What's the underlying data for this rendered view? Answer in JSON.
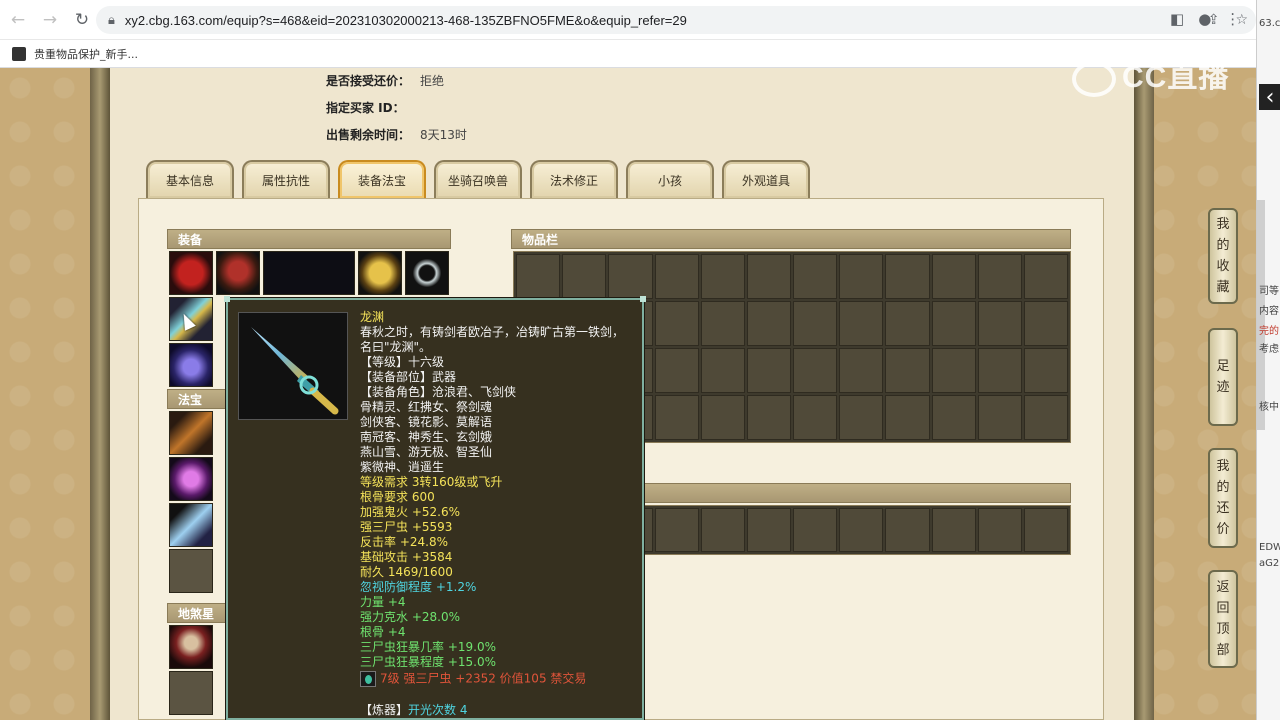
{
  "browser": {
    "url": "xy2.cbg.163.com/equip?s=468&eid=202310302000213-468-135ZBFNO5FME&o&equip_refer=29",
    "bookmark_label": "贵重物品保护_新手..."
  },
  "info": [
    {
      "key": "是否接受还价：",
      "value": "拒绝"
    },
    {
      "key": "指定买家 ID：",
      "value": ""
    },
    {
      "key": "出售剩余时间：",
      "value": "8天13时"
    }
  ],
  "tabs": [
    {
      "label": "基本信息",
      "active": false
    },
    {
      "label": "属性抗性",
      "active": false
    },
    {
      "label": "装备法宝",
      "active": true
    },
    {
      "label": "坐骑召唤兽",
      "active": false
    },
    {
      "label": "法术修正",
      "active": false
    },
    {
      "label": "小孩",
      "active": false
    },
    {
      "label": "外观道具",
      "active": false
    }
  ],
  "sections": {
    "equip": "装备",
    "fabao": "法宝",
    "disha": "地煞星",
    "inventory": "物品栏"
  },
  "tooltip": {
    "name": "龙渊",
    "desc1": "春秋之时，有铸剑者欧冶子，冶铸旷古第一铁剑，",
    "desc2": "名曰\"龙渊\"。",
    "level": "【等级】十六级",
    "slot": "【装备部位】武器",
    "roles1": "【装备角色】沧浪君、飞剑侠",
    "roles2": "骨精灵、红拂女、祭剑魂",
    "roles3": "剑侠客、镜花影、莫解语",
    "roles4": "南冠客、神秀生、玄剑娥",
    "roles5": "燕山雪、游无极、智圣仙",
    "roles6": "紫微神、逍遥生",
    "req_level": "等级需求 3转160级或飞升",
    "req_bone": "根骨要求 600",
    "stat1": "加强鬼火 +52.6%",
    "stat2": "强三尸虫 +5593",
    "stat3": "反击率 +24.8%",
    "stat4": "基础攻击 +3584",
    "durability": "耐久 1469/1600",
    "add1": "忽视防御程度 +1.2%",
    "add2": "力量 +4",
    "add3": "强力克水 +28.0%",
    "add4": "根骨 +4",
    "add5": "三尸虫狂暴几率 +19.0%",
    "add6": "三尸虫狂暴程度 +15.0%",
    "gem": "7级 强三尸虫 +2352 价值105 禁交易",
    "refine_label": "【炼器】",
    "refine_value": "开光次数 4"
  },
  "float_buttons": [
    {
      "chars": [
        "我",
        "的",
        "收",
        "藏"
      ]
    },
    {
      "chars": [
        "足",
        "迹"
      ]
    },
    {
      "chars": [
        "我",
        "的",
        "还",
        "价"
      ]
    },
    {
      "chars": [
        "返",
        "回",
        "顶",
        "部"
      ]
    }
  ],
  "watermark": "CC直播",
  "right_strip_fragments": [
    "63.c",
    "司等",
    "内容",
    "完的",
    "考虑",
    "核中",
    "EDW",
    "aG2"
  ]
}
